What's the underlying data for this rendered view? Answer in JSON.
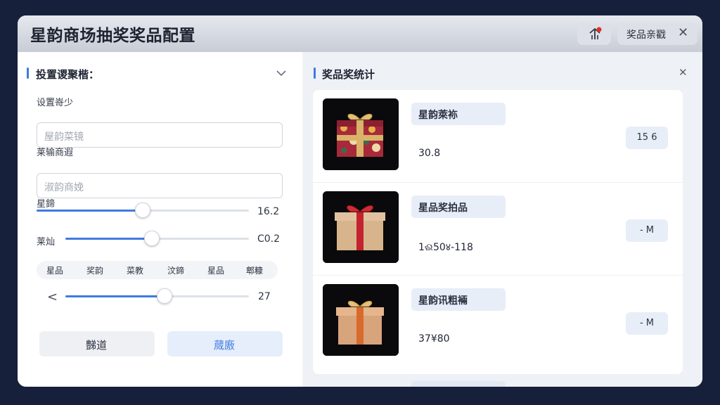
{
  "window": {
    "title": "星韵商场抽奖奖品配置",
    "tab_label": "奖品亲戳",
    "tab_close": "✕"
  },
  "left_panel": {
    "section_title": "投置谡聚楷：",
    "field1": {
      "label": "设置嵜少",
      "placeholder": "屋韵菜镜"
    },
    "field2": {
      "label": "莱输商遐",
      "placeholder": "淑韵商娩"
    },
    "slider1": {
      "label": "星鍗",
      "value_text": "16.2",
      "level_percent": 50
    },
    "slider2": {
      "label": "莱灿",
      "value_text": "C0.2",
      "level_percent": 47
    },
    "chips": [
      "星品",
      "奖韵",
      "菜教",
      "汶鍗",
      "星品",
      "郫糠"
    ],
    "slider3": {
      "prefix": "<",
      "value_text": "27",
      "level_percent": 54
    },
    "buttons": {
      "secondary": "豑道",
      "primary": "蒇廒"
    }
  },
  "right_panel": {
    "section_title": "奖品奖统计",
    "close": "✕",
    "items": [
      {
        "name": "星韵萊袮",
        "value": "30.8",
        "badge": "15 6"
      },
      {
        "name": "星品奖拍品",
        "value": "1ଈ50४-118",
        "badge": "- M"
      },
      {
        "name": "星韵讯粗裲",
        "value": "37¥80",
        "badge": "- M"
      }
    ]
  },
  "colors": {
    "accent": "#3f7be0",
    "background": "#17203a",
    "primary_button_bg": "#e6eefb",
    "primary_button_text": "#3f7be0"
  },
  "icons": [
    "share-icon",
    "notification-dot-icon",
    "close-icon",
    "chevron-down-icon",
    "gift-box-icon"
  ]
}
